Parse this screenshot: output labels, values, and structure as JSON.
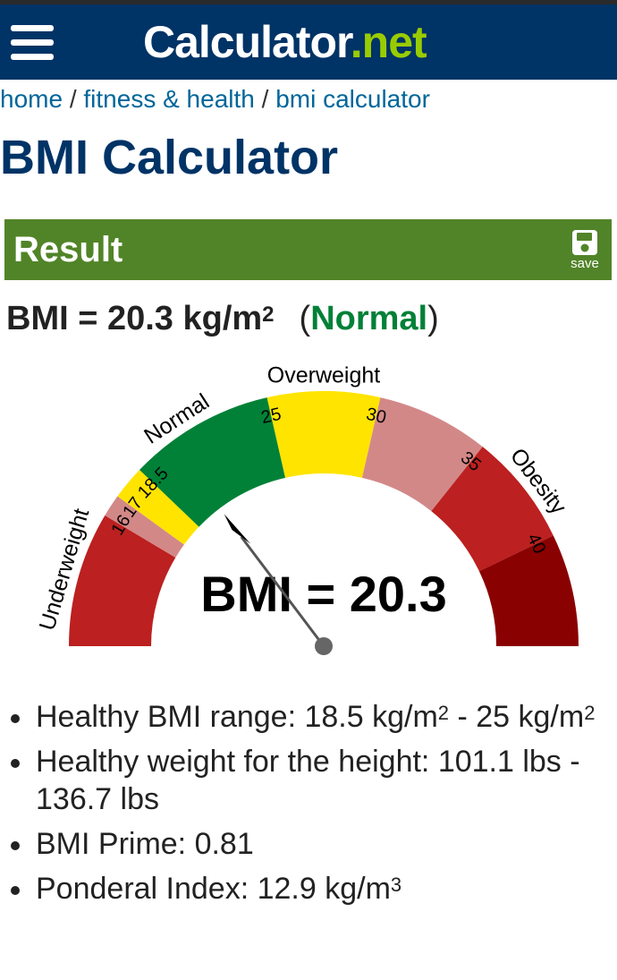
{
  "header": {
    "logo_main": "Calculator",
    "logo_dot": ".",
    "logo_net": "net"
  },
  "breadcrumb": {
    "home": "home",
    "sep1": " / ",
    "fitness": "fitness & health",
    "sep2": " / ",
    "current": "bmi calculator"
  },
  "page_title": "BMI Calculator",
  "result": {
    "title": "Result",
    "save_label": "save",
    "bmi_prefix": "BMI = 20.3 kg/m",
    "bmi_sup": "2",
    "paren_open": "(",
    "category": "Normal",
    "paren_close": ")"
  },
  "gauge": {
    "bmi_value": 20.3,
    "readout": "BMI = 20.3",
    "range": [
      10,
      45
    ],
    "segments": [
      {
        "from": 10,
        "to": 16,
        "color": "#bc2020"
      },
      {
        "from": 16,
        "to": 17,
        "color": "#d38888"
      },
      {
        "from": 17,
        "to": 18.5,
        "color": "#ffe400"
      },
      {
        "from": 18.5,
        "to": 25,
        "color": "#008137"
      },
      {
        "from": 25,
        "to": 30,
        "color": "#ffe400"
      },
      {
        "from": 30,
        "to": 35,
        "color": "#d38888"
      },
      {
        "from": 35,
        "to": 40,
        "color": "#bc2020"
      },
      {
        "from": 40,
        "to": 45,
        "color": "#8a0101"
      }
    ],
    "ticks": [
      {
        "value": 16,
        "label": "16"
      },
      {
        "value": 17,
        "label": "17"
      },
      {
        "value": 18.5,
        "label": "18.5"
      },
      {
        "value": 25,
        "label": "25"
      },
      {
        "value": 30,
        "label": "30"
      },
      {
        "value": 35,
        "label": "35"
      },
      {
        "value": 40,
        "label": "40"
      }
    ],
    "categories": [
      {
        "label": "Underweight",
        "center": 13.2
      },
      {
        "label": "Normal",
        "center": 21.1
      },
      {
        "label": "Overweight",
        "center": 27.5
      },
      {
        "label": "Obesity",
        "center": 37.7
      }
    ]
  },
  "details": {
    "healthy_range_prefix": "Healthy BMI range: 18.5 kg/m",
    "healthy_range_sup1": "2",
    "healthy_range_mid": " - 25 kg/m",
    "healthy_range_sup2": "2",
    "healthy_weight": "Healthy weight for the height: 101.1 lbs - 136.7 lbs",
    "bmi_prime": "BMI Prime: 0.81",
    "ponderal_prefix": "Ponderal Index: 12.9 kg/m",
    "ponderal_sup": "3"
  }
}
